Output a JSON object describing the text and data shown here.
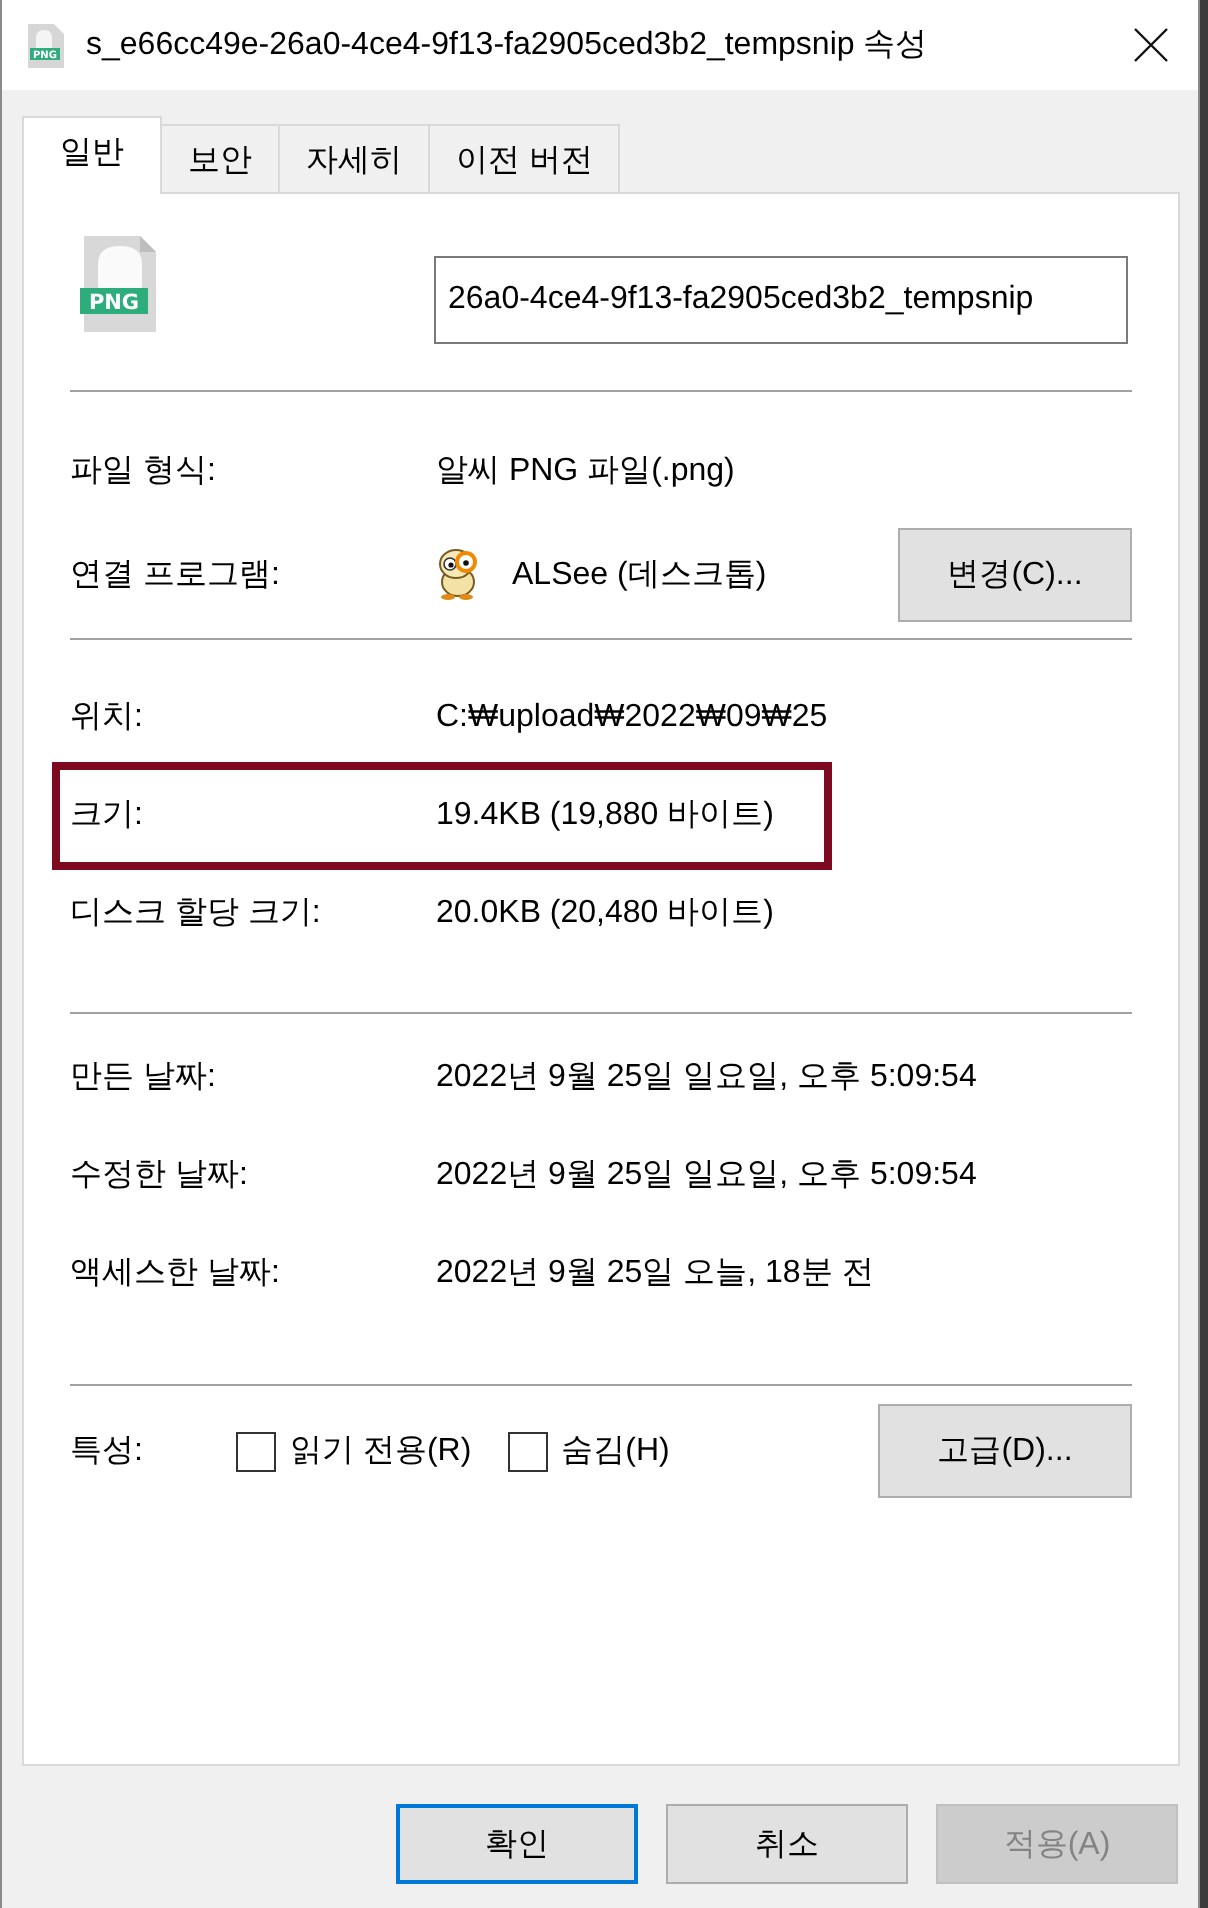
{
  "window": {
    "title": "s_e66cc49e-26a0-4ce4-9f13-fa2905ced3b2_tempsnip 속성",
    "icon_text": "PNG"
  },
  "tabs": [
    {
      "label": "일반",
      "selected": true
    },
    {
      "label": "보안",
      "selected": false
    },
    {
      "label": "자세히",
      "selected": false
    },
    {
      "label": "이전 버전",
      "selected": false
    }
  ],
  "file": {
    "icon_text": "PNG",
    "name": "26a0-4ce4-9f13-fa2905ced3b2_tempsnip"
  },
  "sections": [
    {
      "rows": [
        {
          "kind": "text",
          "label": "파일 형식:",
          "value": "알씨 PNG 파일(.png)"
        },
        {
          "kind": "app",
          "label": "연결 프로그램:",
          "value": "ALSee (데스크톱)",
          "button": "변경(C)..."
        }
      ]
    },
    {
      "rows": [
        {
          "kind": "text",
          "label": "위치:",
          "value": "C:₩upload₩2022₩09₩25",
          "highlighted": false
        },
        {
          "kind": "text",
          "label": "크기:",
          "value": "19.4KB (19,880 바이트)",
          "highlighted": true
        },
        {
          "kind": "text",
          "label": "디스크 할당 크기:",
          "value": "20.0KB (20,480 바이트)",
          "highlighted": false
        }
      ]
    },
    {
      "rows": [
        {
          "kind": "text",
          "label": "만든 날짜:",
          "value": "2022년 9월 25일 일요일, 오후 5:09:54"
        },
        {
          "kind": "text",
          "label": "수정한 날짜:",
          "value": "2022년 9월 25일 일요일, 오후 5:09:54"
        },
        {
          "kind": "text",
          "label": "액세스한 날짜:",
          "value": "2022년 9월 25일 오늘, 18분 전"
        }
      ]
    },
    {
      "rows": [
        {
          "kind": "attributes",
          "label": "특성:",
          "checkboxes": [
            {
              "label": "읽기 전용(R)",
              "checked": false
            },
            {
              "label": "숨김(H)",
              "checked": false
            }
          ],
          "button": "고급(D)..."
        }
      ]
    }
  ],
  "footer_buttons": [
    {
      "label": "확인",
      "default": true,
      "disabled": false
    },
    {
      "label": "취소",
      "default": false,
      "disabled": false
    },
    {
      "label": "적용(A)",
      "default": false,
      "disabled": true
    }
  ]
}
